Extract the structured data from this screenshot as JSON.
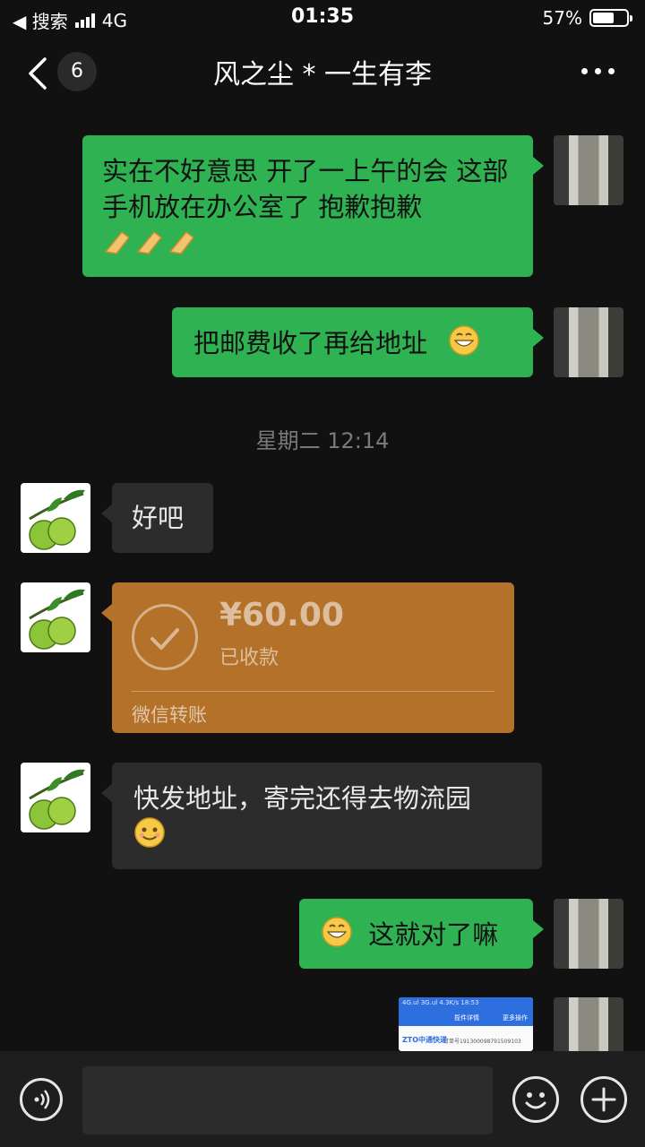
{
  "status_bar": {
    "back_app": "◀ 搜索",
    "network": "4G",
    "time": "01:35",
    "battery": "57%",
    "battery_level": 0.57
  },
  "nav": {
    "unread_count": "6",
    "title": "风之尘 * 一生有李"
  },
  "messages": {
    "m1": "实在不好意思 开了一上午的会 这部手机放在办公室了 抱歉抱歉",
    "m2": "把邮费收了再给地址",
    "timestamp": "星期二 12:14",
    "m3": "好吧",
    "transfer": {
      "amount": "¥60.00",
      "status": "已收款",
      "footer": "微信转账",
      "color": "#b3712a"
    },
    "m4": "快发地址，寄完还得去物流园",
    "m5": "这就对了嘛",
    "screenshot_thumb": {
      "status_text": "4G.ul 3G.ul 4.3K/s  18:53",
      "title": "揽件详情",
      "action": "更多操作",
      "logo": "ZTO中通快递",
      "order_no": "订单号1913000987915091​03"
    }
  },
  "colors": {
    "self_bubble": "#2fb352",
    "other_bubble": "#2c2c2c",
    "background": "#111111"
  }
}
